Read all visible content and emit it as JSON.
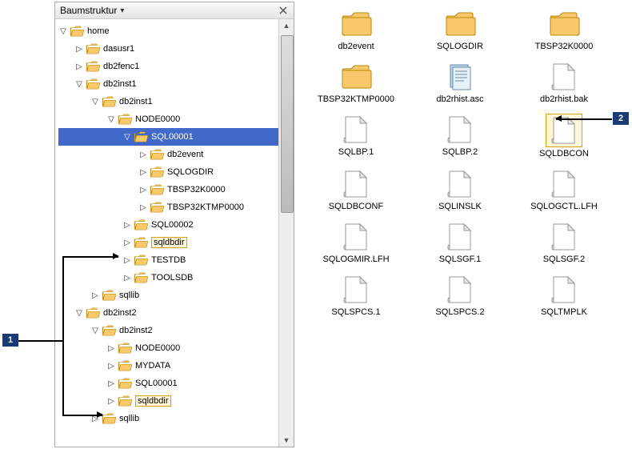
{
  "panel": {
    "title": "Baumstruktur"
  },
  "tree": [
    {
      "indent": 0,
      "state": "open",
      "label": "home"
    },
    {
      "indent": 1,
      "state": "closed",
      "label": "dasusr1"
    },
    {
      "indent": 1,
      "state": "closed",
      "label": "db2fenc1"
    },
    {
      "indent": 1,
      "state": "open",
      "label": "db2inst1"
    },
    {
      "indent": 2,
      "state": "open",
      "label": "db2inst1"
    },
    {
      "indent": 3,
      "state": "open",
      "label": "NODE0000"
    },
    {
      "indent": 4,
      "state": "open",
      "label": "SQL00001",
      "selected": true
    },
    {
      "indent": 5,
      "state": "closed",
      "label": "db2event"
    },
    {
      "indent": 5,
      "state": "closed",
      "label": "SQLOGDIR"
    },
    {
      "indent": 5,
      "state": "closed",
      "label": "TBSP32K0000"
    },
    {
      "indent": 5,
      "state": "closed",
      "label": "TBSP32KTMP0000"
    },
    {
      "indent": 4,
      "state": "closed",
      "label": "SQL00002"
    },
    {
      "indent": 4,
      "state": "closed",
      "label": "sqldbdir",
      "hl": true
    },
    {
      "indent": 4,
      "state": "closed",
      "label": "TESTDB"
    },
    {
      "indent": 4,
      "state": "closed",
      "label": "TOOLSDB"
    },
    {
      "indent": 2,
      "state": "closed",
      "label": "sqllib"
    },
    {
      "indent": 1,
      "state": "open",
      "label": "db2inst2"
    },
    {
      "indent": 2,
      "state": "open",
      "label": "db2inst2"
    },
    {
      "indent": 3,
      "state": "closed",
      "label": "NODE0000"
    },
    {
      "indent": 3,
      "state": "closed",
      "label": "MYDATA"
    },
    {
      "indent": 3,
      "state": "closed",
      "label": "SQL00001"
    },
    {
      "indent": 3,
      "state": "closed",
      "label": "sqldbdir",
      "hl": true
    },
    {
      "indent": 2,
      "state": "closed",
      "label": "sqllib"
    }
  ],
  "content": [
    {
      "type": "folder",
      "label": "db2event"
    },
    {
      "type": "folder",
      "label": "SQLOGDIR"
    },
    {
      "type": "folder",
      "label": "TBSP32K0000"
    },
    {
      "type": "folder",
      "label": "TBSP32KTMP0000"
    },
    {
      "type": "file-asc",
      "label": "db2rhist.asc"
    },
    {
      "type": "file",
      "label": "db2rhist.bak"
    },
    {
      "type": "file",
      "label": "SQLBP.1"
    },
    {
      "type": "file",
      "label": "SQLBP.2"
    },
    {
      "type": "file",
      "label": "SQLDBCON",
      "selected": true
    },
    {
      "type": "file",
      "label": "SQLDBCONF"
    },
    {
      "type": "file",
      "label": "SQLINSLK"
    },
    {
      "type": "file",
      "label": "SQLOGCTL.LFH"
    },
    {
      "type": "file",
      "label": "SQLOGMIR.LFH"
    },
    {
      "type": "file",
      "label": "SQLSGF.1"
    },
    {
      "type": "file",
      "label": "SQLSGF.2"
    },
    {
      "type": "file",
      "label": "SQLSPCS.1"
    },
    {
      "type": "file",
      "label": "SQLSPCS.2"
    },
    {
      "type": "file",
      "label": "SQLTMPLK"
    }
  ],
  "callouts": {
    "left": "1",
    "right": "2"
  }
}
